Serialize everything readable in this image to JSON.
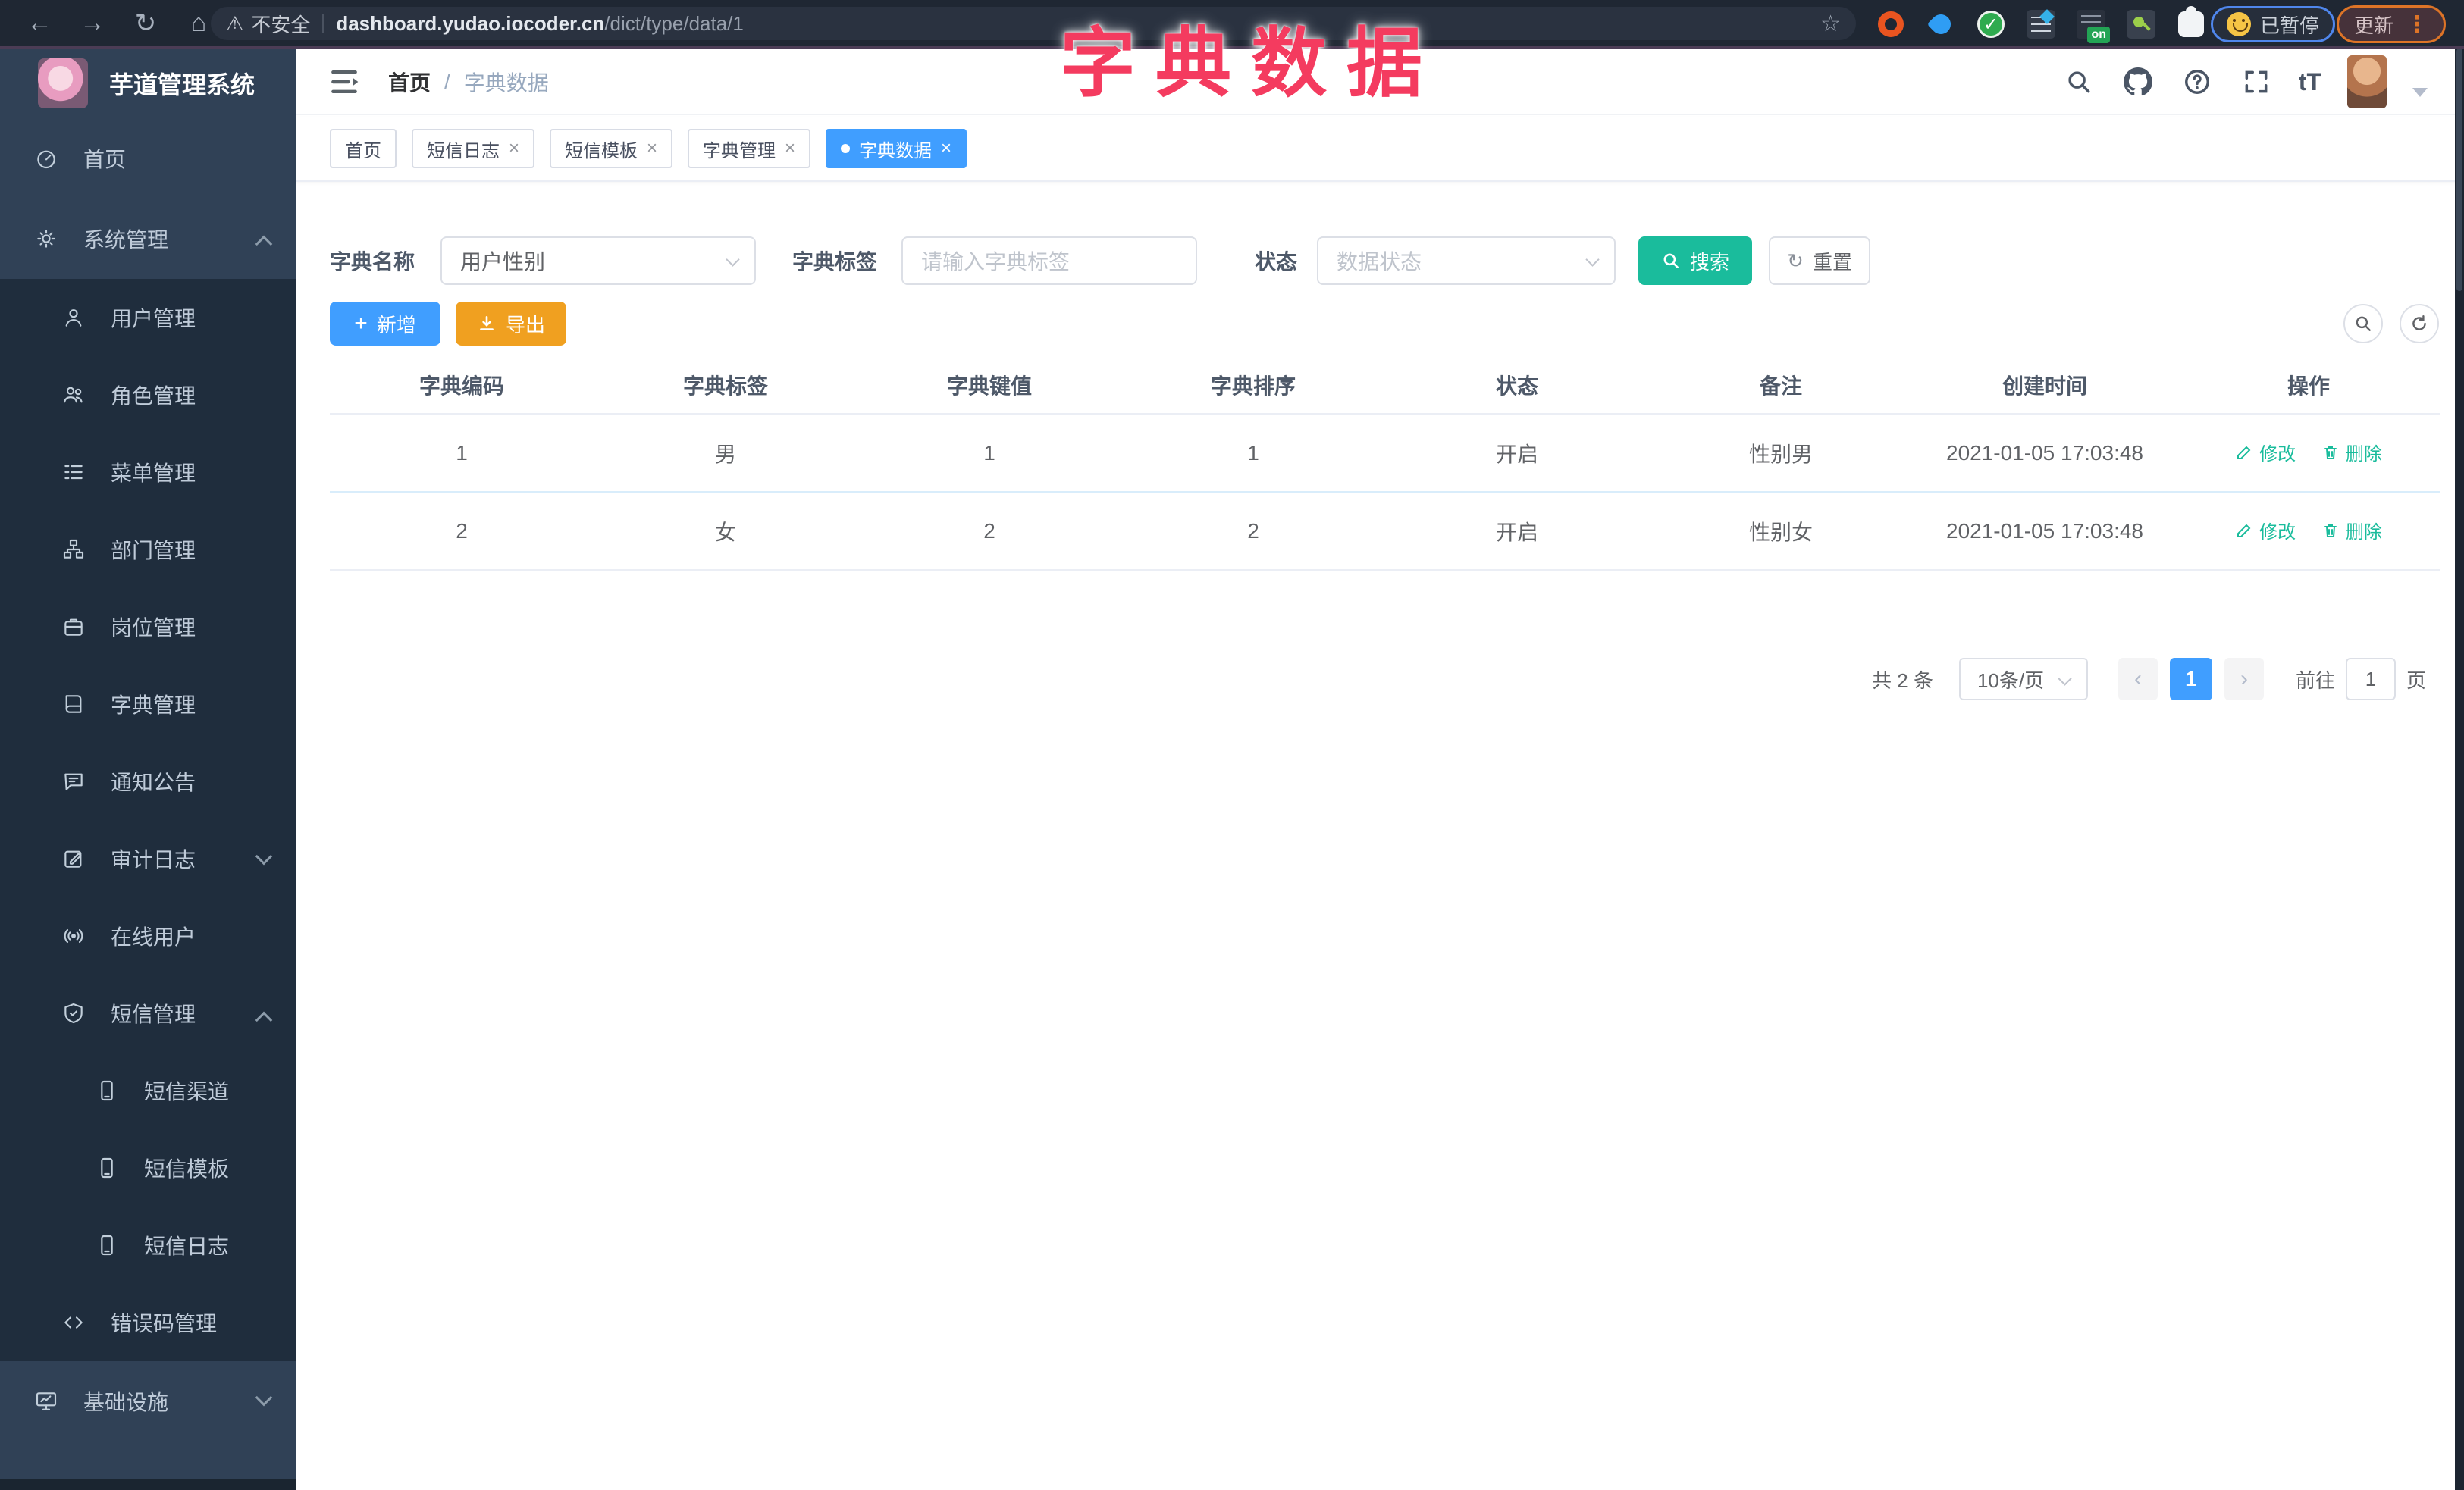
{
  "colors": {
    "accent_blue": "#409eff",
    "teal": "#1abc9c",
    "warning_orange": "#f0a020",
    "overlay_pink": "#f43b5f",
    "sidebar_bg": "#304156",
    "submenu_bg": "#1f2d3d",
    "chrome_bg": "#1f2733"
  },
  "browser": {
    "back_icon": "←",
    "forward_icon": "→",
    "reload_icon": "↻",
    "home_icon": "⌂",
    "warning_icon": "⚠",
    "security_label": "不安全",
    "url_host": "dashboard.yudao.iocoder.cn",
    "url_path": "/dict/type/data/1",
    "star_icon": "☆",
    "extension_on_badge": "on",
    "paused_badge": "已暂停",
    "update_button": "更新",
    "menu_dots": "⋮"
  },
  "overlay_title": "字典数据",
  "sidebar": {
    "title": "芋道管理系统",
    "items": [
      {
        "label": "首页"
      },
      {
        "label": "系统管理"
      },
      {
        "label": "用户管理"
      },
      {
        "label": "角色管理"
      },
      {
        "label": "菜单管理"
      },
      {
        "label": "部门管理"
      },
      {
        "label": "岗位管理"
      },
      {
        "label": "字典管理"
      },
      {
        "label": "通知公告"
      },
      {
        "label": "审计日志"
      },
      {
        "label": "在线用户"
      },
      {
        "label": "短信管理"
      },
      {
        "label": "短信渠道"
      },
      {
        "label": "短信模板"
      },
      {
        "label": "短信日志"
      },
      {
        "label": "错误码管理"
      },
      {
        "label": "基础设施"
      }
    ]
  },
  "header": {
    "breadcrumb_home": "首页",
    "breadcrumb_sep": "/",
    "breadcrumb_current": "字典数据",
    "font_size_icon_label": "tT"
  },
  "tabs": [
    {
      "label": "首页"
    },
    {
      "label": "短信日志"
    },
    {
      "label": "短信模板"
    },
    {
      "label": "字典管理"
    },
    {
      "label": "字典数据"
    }
  ],
  "tab_close_icon": "×",
  "filters": {
    "name_label": "字典名称",
    "name_value": "用户性别",
    "tag_label": "字典标签",
    "tag_placeholder": "请输入字典标签",
    "status_label": "状态",
    "status_placeholder": "数据状态",
    "search_button": "搜索",
    "reset_button": "重置",
    "reset_icon": "↻"
  },
  "toolbar": {
    "add_button": "新增",
    "add_icon": "+",
    "export_button": "导出"
  },
  "table": {
    "columns": [
      "字典编码",
      "字典标签",
      "字典键值",
      "字典排序",
      "状态",
      "备注",
      "创建时间",
      "操作"
    ],
    "rows": [
      {
        "code": "1",
        "label": "男",
        "value": "1",
        "sort": "1",
        "status": "开启",
        "remark": "性别男",
        "created": "2021-01-05 17:03:48"
      },
      {
        "code": "2",
        "label": "女",
        "value": "2",
        "sort": "2",
        "status": "开启",
        "remark": "性别女",
        "created": "2021-01-05 17:03:48"
      }
    ],
    "edit_label": "修改",
    "delete_label": "删除"
  },
  "pagination": {
    "total_label": "共 2 条",
    "page_size_label": "10条/页",
    "prev_icon": "‹",
    "page_number": "1",
    "next_icon": "›",
    "goto_label": "前往",
    "goto_value": "1",
    "page_unit_label": "页"
  }
}
